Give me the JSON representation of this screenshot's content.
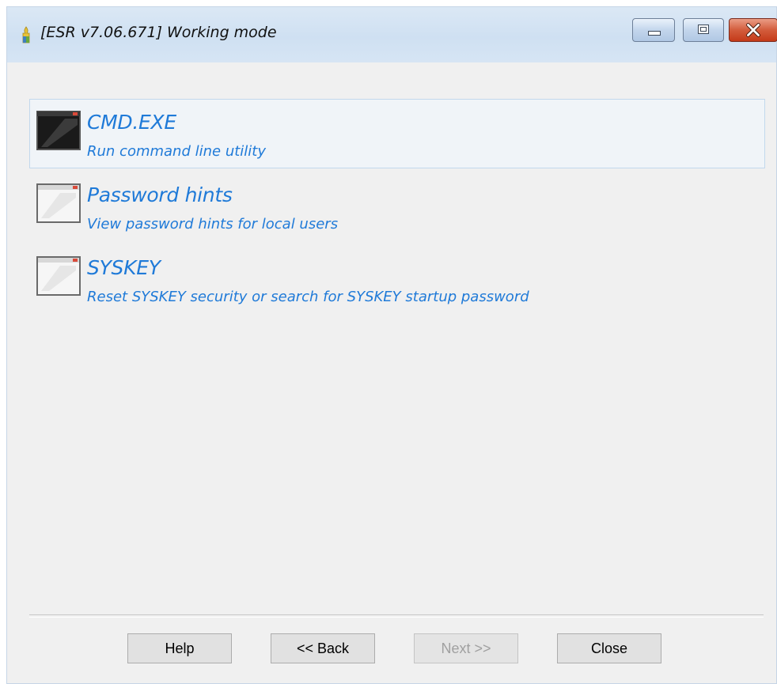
{
  "window": {
    "title": "[ESR v7.06.671]  Working mode"
  },
  "menu": {
    "items": [
      {
        "title": "CMD.EXE",
        "description": "Run command line utility",
        "icon": "cmd-console-icon",
        "selected": true
      },
      {
        "title": "Password hints",
        "description": "View password hints for local users",
        "icon": "window-icon",
        "selected": false
      },
      {
        "title": "SYSKEY",
        "description": "Reset SYSKEY security or search for SYSKEY startup password",
        "icon": "window-icon",
        "selected": false
      }
    ]
  },
  "footer": {
    "help_label": "Help",
    "back_label": "<< Back",
    "next_label": "Next >>",
    "close_label": "Close"
  },
  "colors": {
    "link_blue": "#1f7ad8",
    "window_bg": "#f0f0f0",
    "close_red": "#c43a19"
  }
}
